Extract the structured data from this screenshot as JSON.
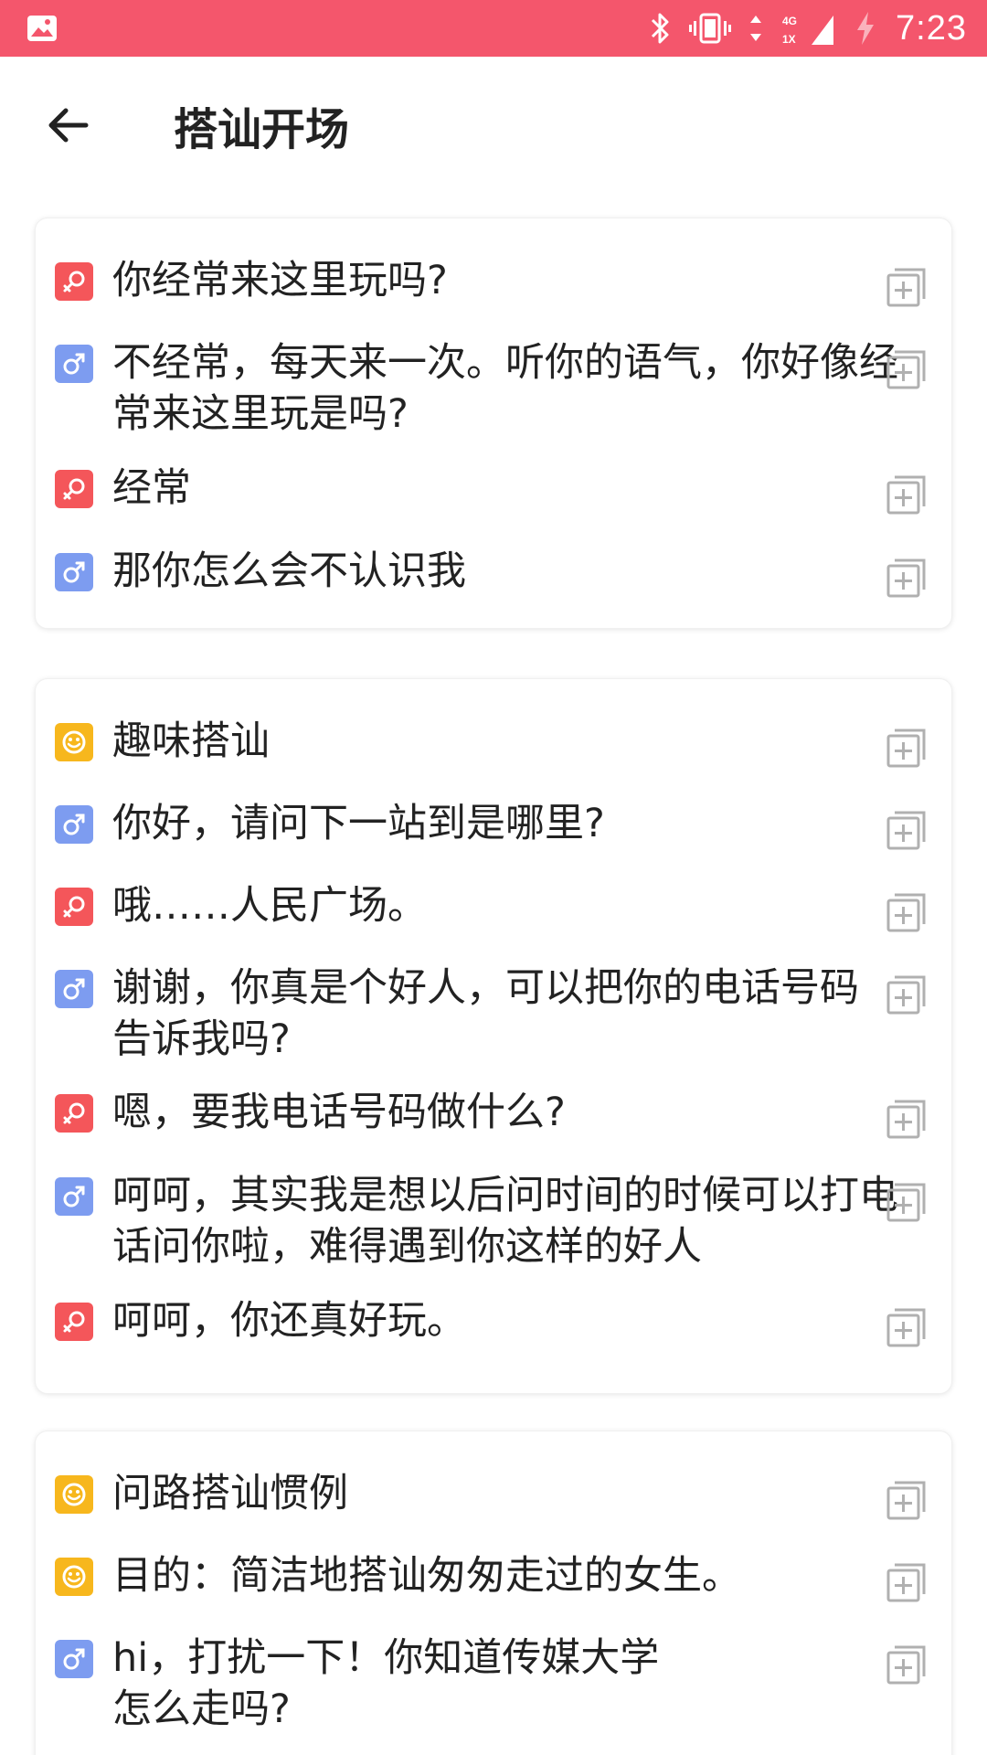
{
  "status_bar": {
    "time": "7:23",
    "network_top": "4G",
    "network_bottom": "1X",
    "background": "#f4566c"
  },
  "header": {
    "title": "搭讪开场",
    "back_icon": "arrow-left-icon"
  },
  "cards": [
    {
      "items": [
        {
          "role": "female",
          "text": "你经常来这里玩吗?"
        },
        {
          "role": "male",
          "text": "不经常，每天来一次。听你的语气，你好像经常来这里玩是吗?"
        },
        {
          "role": "female",
          "text": "经常"
        },
        {
          "role": "male",
          "text": "那你怎么会不认识我"
        }
      ]
    },
    {
      "items": [
        {
          "role": "topic",
          "text": "趣味搭讪"
        },
        {
          "role": "male",
          "text": "你好，请问下一站到是哪里?"
        },
        {
          "role": "female",
          "text": "哦……人民广场。"
        },
        {
          "role": "male",
          "text": "谢谢，你真是个好人，可以把你的电话号码告诉我吗?"
        },
        {
          "role": "female",
          "text": "嗯，要我电话号码做什么?"
        },
        {
          "role": "male",
          "text": "呵呵，其实我是想以后问时间的时候可以打电话问你啦，难得遇到你这样的好人"
        },
        {
          "role": "female",
          "text": "呵呵，你还真好玩。"
        }
      ]
    },
    {
      "items": [
        {
          "role": "topic",
          "text": "问路搭讪惯例"
        },
        {
          "role": "topic",
          "text": "目的：简洁地搭讪匆匆走过的女生。"
        },
        {
          "role": "male",
          "text": "hi，打扰一下！你知道传媒大学\n怎么走吗?"
        }
      ]
    }
  ],
  "colors": {
    "female_badge": "#f4565a",
    "male_badge": "#7d9cf0",
    "topic_badge": "#f7b71d",
    "copy_icon": "#b0b0b0"
  },
  "icons": {
    "female": "female-symbol-icon",
    "male": "male-symbol-icon",
    "topic": "smile-icon",
    "copy": "copy-add-icon"
  }
}
